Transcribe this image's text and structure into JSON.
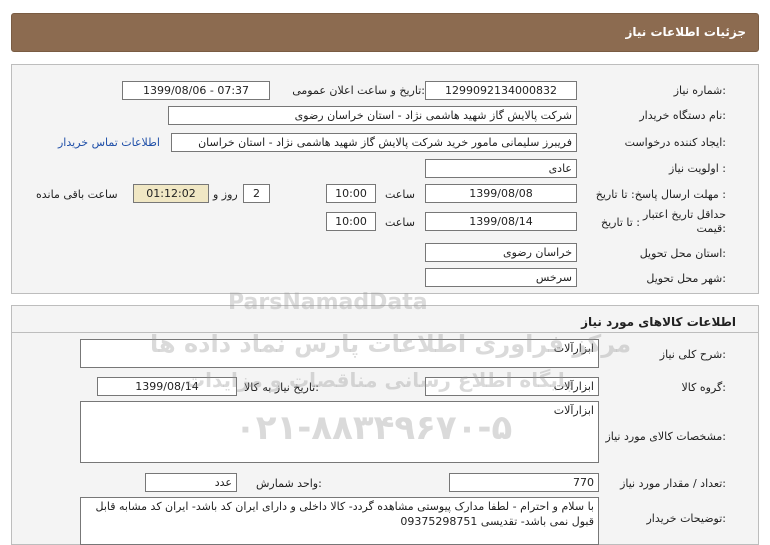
{
  "header": {
    "title": "جزئیات اطلاعات نیاز"
  },
  "fields": {
    "need_number": {
      "label": "شماره نیاز:",
      "value": "1299092134000832"
    },
    "announce_datetime": {
      "label": "تاریخ و ساعت اعلان عمومی:",
      "value": "1399/08/06 - 07:37"
    },
    "buyer_org": {
      "label": "نام دستگاه خریدار:",
      "value": "شرکت پالایش گاز شهید هاشمی نژاد - استان خراسان رضوی"
    },
    "requester": {
      "label": "ایجاد کننده درخواست:",
      "value": "فریبرز  سلیمانی مامور خرید شرکت پالایش گاز شهید هاشمی نژاد - استان خراسان"
    },
    "buyer_contact_link": "اطلاعات تماس خریدار",
    "priority": {
      "label": "اولویت نیاز :",
      "value": "عادی"
    },
    "reply_deadline": {
      "label": "مهلت ارسال پاسخ: تا تاریخ :",
      "date": "1399/08/08",
      "time_label": "ساعت",
      "time": "10:00",
      "days": "2",
      "days_label": "روز و",
      "remaining": "01:12:02",
      "remaining_label": "ساعت باقی مانده"
    },
    "price_validity": {
      "label_line1": "حداقل تاریخ اعتبار",
      "label_line2": "قیمت:",
      "to_date_label": "تا تاریخ :",
      "date": "1399/08/14",
      "time_label": "ساعت",
      "time": "10:00"
    },
    "delivery_province": {
      "label": "استان محل تحویل:",
      "value": "خراسان رضوی"
    },
    "delivery_city": {
      "label": "شهر محل تحویل:",
      "value": "سرخس"
    }
  },
  "goods": {
    "section_title": "اطلاعات کالاهای مورد نیاز",
    "general_desc": {
      "label": "شرح کلی نیاز:",
      "value": "ابزارآلات"
    },
    "goods_group": {
      "label": "گروه کالا:",
      "value": "ابزارآلات"
    },
    "need_date": {
      "label": "تاریخ نیاز به کالا:",
      "value": "1399/08/14"
    },
    "specs": {
      "label": "مشخصات کالای مورد نیاز:",
      "value": "ابزارآلات"
    },
    "quantity": {
      "label": "تعداد / مقدار مورد نیاز:",
      "value": "770"
    },
    "unit": {
      "label": "واحد شمارش:",
      "value": "عدد"
    },
    "buyer_notes": {
      "label": "توضیحات خریدار:",
      "value": "با سلام و احترام - لطفا مدارک پیوستی مشاهده گردد- کالا داخلی و دارای ایران کد باشد- ایران کد مشابه قابل قبول نمی باشد- تقدیسی 09375298751"
    }
  },
  "watermark": {
    "brand": "ParsNamadData",
    "line1": "مرکز فراوری اطلاعات پارس نماد داده ها",
    "line2": "پایگاه اطلاع رسانی مناقصات و مزایدات",
    "phone": "۰۲۱-۸۸۳۴۹۶۷۰-۵"
  }
}
